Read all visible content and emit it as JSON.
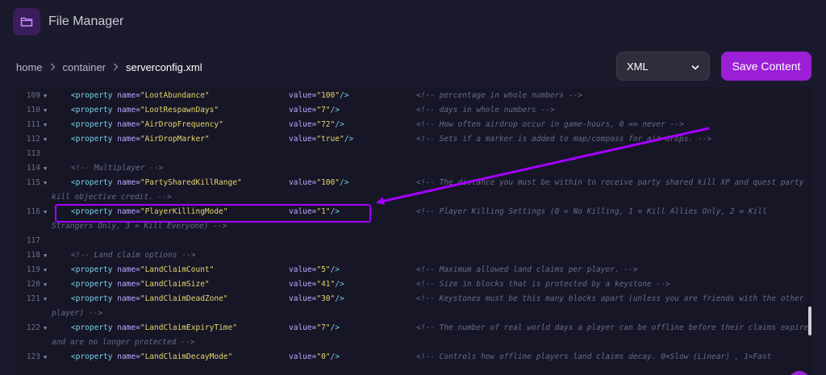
{
  "app": {
    "title": "File Manager",
    "icon": "folder-icon"
  },
  "breadcrumb": {
    "items": [
      "home",
      "container",
      "serverconfig.xml"
    ]
  },
  "toolbar": {
    "format_selected": "XML",
    "save_label": "Save Content"
  },
  "colors": {
    "accent": "#9b1fd6",
    "highlight": "#a400ff",
    "background": "#1a1a2c",
    "editor_bg": "#161627"
  },
  "editor": {
    "lines": [
      {
        "num": "109",
        "fold": true,
        "kind": "prop",
        "name": "LootAbundance",
        "value": "100",
        "comment": "<!-- percentage in whole numbers -->"
      },
      {
        "num": "110",
        "fold": true,
        "kind": "prop",
        "name": "LootRespawnDays",
        "value": "7",
        "comment": "<!-- days in whole numbers -->"
      },
      {
        "num": "111",
        "fold": true,
        "kind": "prop",
        "name": "AirDropFrequency",
        "value": "72",
        "comment": "<!-- How often airdrop occur in game-hours, 0 == never -->"
      },
      {
        "num": "112",
        "fold": true,
        "kind": "prop",
        "name": "AirDropMarker",
        "value": "true",
        "comment": "<!-- Sets if a marker is added to map/compass for air drops. -->"
      },
      {
        "num": "113",
        "fold": false,
        "kind": "empty"
      },
      {
        "num": "114",
        "fold": true,
        "kind": "comment",
        "text": "<!-- Multiplayer -->"
      },
      {
        "num": "115",
        "fold": true,
        "kind": "prop",
        "name": "PartySharedKillRange",
        "value": "100",
        "comment": "<!-- The distance you must be within to receive party shared kill XP and quest party",
        "wrap": "kill objective credit. -->"
      },
      {
        "num": "116",
        "fold": true,
        "kind": "prop",
        "name": "PlayerKillingMode",
        "value": "1",
        "comment": "<!-- Player Killing Settings (0 = No Killing, 1 = Kill Allies Only, 2 = Kill",
        "wrap": "Strangers Only, 3 = Kill Everyone) -->"
      },
      {
        "num": "117",
        "fold": false,
        "kind": "empty"
      },
      {
        "num": "118",
        "fold": true,
        "kind": "comment",
        "text": "<!-- Land claim options -->"
      },
      {
        "num": "119",
        "fold": true,
        "kind": "prop",
        "name": "LandClaimCount",
        "value": "5",
        "comment": "<!-- Maximum allowed land claims per player. -->"
      },
      {
        "num": "120",
        "fold": true,
        "kind": "prop",
        "name": "LandClaimSize",
        "value": "41",
        "comment": "<!-- Size in blocks that is protected by a keystone -->"
      },
      {
        "num": "121",
        "fold": true,
        "kind": "prop",
        "name": "LandClaimDeadZone",
        "value": "30",
        "comment": "<!-- Keystones must be this many blocks apart (unless you are friends with the other",
        "wrap": "player) -->"
      },
      {
        "num": "122",
        "fold": true,
        "kind": "prop",
        "name": "LandClaimExpiryTime",
        "value": "7",
        "comment": "<!-- The number of real world days a player can be offline before their claims expire",
        "wrap": "and are no longer protected -->"
      },
      {
        "num": "123",
        "fold": true,
        "kind": "prop",
        "name": "LandClaimDecayMode",
        "value": "0",
        "comment": "<!-- Controls how offline players land claims decay. 0=Slow (Linear) , 1=Fast"
      }
    ]
  }
}
